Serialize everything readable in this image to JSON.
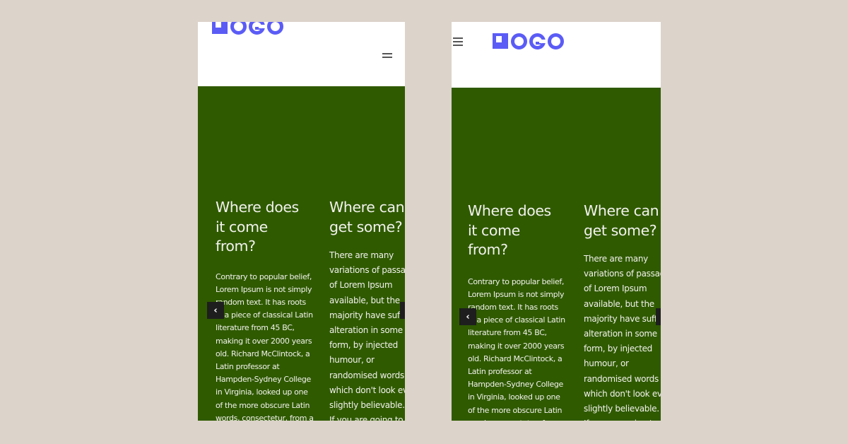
{
  "logo": {
    "text": "LOGO",
    "color": "#5b5cf6"
  },
  "colors": {
    "page_bg": "#dcd3ca",
    "hero_bg": "#2f5a00",
    "nav_btn_bg": "#1e1e1e",
    "text": "#f2f2ec"
  },
  "icons": {
    "menu": "hamburger-menu-icon",
    "prev": "chevron-left-icon",
    "next": "chevron-right-icon"
  },
  "prev_glyph": "‹",
  "next_glyph": "›",
  "columns": [
    {
      "heading_lines": [
        "Where does",
        "it come",
        "from?"
      ],
      "body_lines": [
        "Contrary to popular belief,",
        "Lorem Ipsum is not simply",
        "random text. It has roots",
        "in a piece of classical Latin",
        "literature from 45 BC,",
        "making it over 2000 years",
        "old. Richard McClintock, a",
        "Latin professor at",
        "Hampden-Sydney College",
        "in Virginia, looked up one",
        "of the more obscure Latin",
        "words, consectetur, from a"
      ]
    },
    {
      "heading_lines": [
        "Where can I",
        "get some?"
      ],
      "body_lines": [
        "There are many",
        "variations of passages",
        "of Lorem Ipsum",
        "available, but the",
        "majority have suffered",
        "alteration in some",
        "form, by injected",
        "humour, or",
        "randomised words",
        "which don't look even",
        "slightly believable.",
        "If you are going to"
      ]
    }
  ]
}
